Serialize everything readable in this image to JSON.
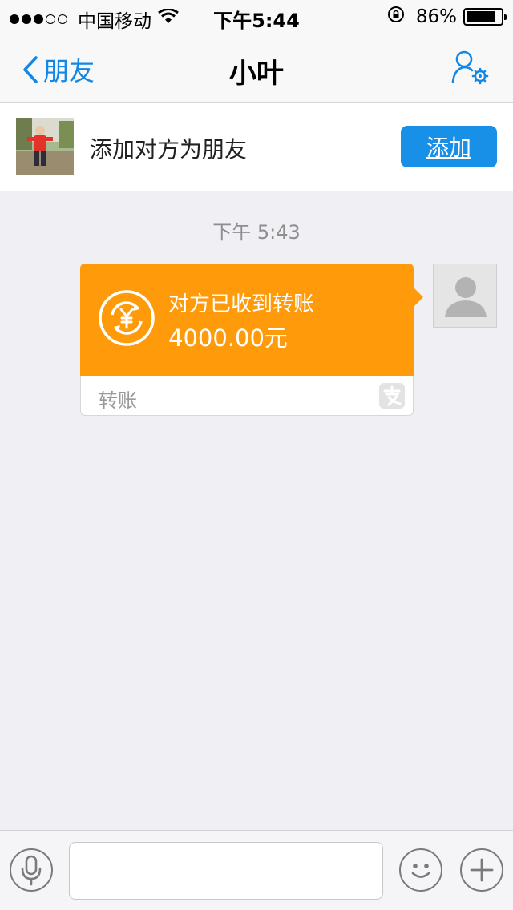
{
  "status_bar": {
    "carrier": "中国移动",
    "time": "下午5:44",
    "battery_percent_label": "86%",
    "battery_level": 0.86,
    "icons": [
      "signal-dots",
      "wifi-icon",
      "rotation-lock-icon",
      "battery-icon"
    ]
  },
  "nav": {
    "back_label": "朋友",
    "title": "小叶",
    "settings_icon": "user-settings-icon",
    "accent_color": "#1187e8"
  },
  "add_friend": {
    "prompt": "添加对方为朋友",
    "button_label": "添加",
    "button_color": "#1890e8"
  },
  "chat": {
    "timestamp": "下午 5:43",
    "messages": [
      {
        "type": "transfer",
        "status_text": "对方已收到转账",
        "amount": "4000.00元",
        "footer_label": "转账",
        "icon": "currency-yuan-icon",
        "badge_icon": "alipay-icon",
        "card_color": "#ff9a0a"
      }
    ]
  },
  "input_bar": {
    "value": "",
    "placeholder": "",
    "icons": [
      "microphone-icon",
      "emoji-icon",
      "plus-icon"
    ]
  }
}
